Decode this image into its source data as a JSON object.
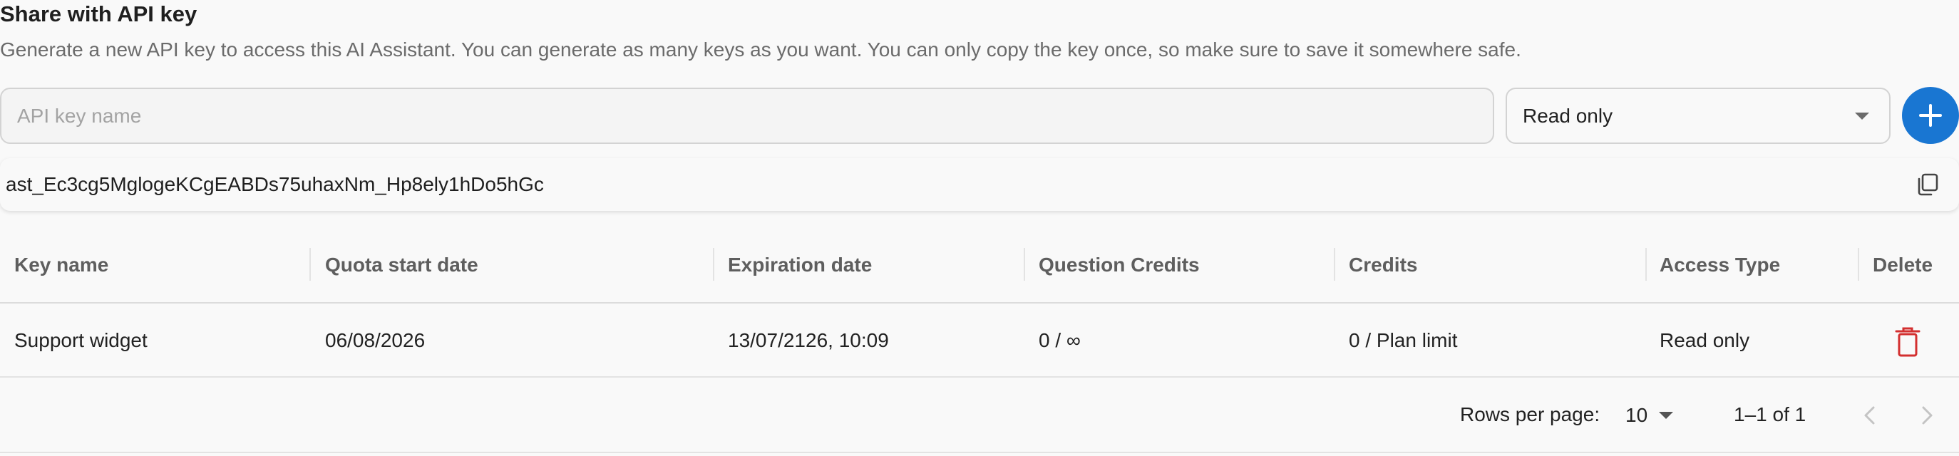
{
  "header": {
    "title": "Share with API key",
    "description": "Generate a new API key to access this AI Assistant. You can generate as many keys as you want. You can only copy the key once, so make sure to save it somewhere safe."
  },
  "form": {
    "name_placeholder": "API key name",
    "name_value": "",
    "access_selected": "Read only",
    "add_icon": "plus-icon",
    "accent_color": "#1976d2"
  },
  "generated_key": {
    "value": "ast_Ec3cg5MglogeKCgEABDs75uhaxNm_Hp8ely1hDo5hGc",
    "copy_icon": "copy-icon"
  },
  "table": {
    "columns": [
      "Key name",
      "Quota start date",
      "Expiration date",
      "Question Credits",
      "Credits",
      "Access Type",
      "Delete"
    ],
    "rows": [
      {
        "key_name": "Support widget",
        "quota_start": "06/08/2026",
        "expiration": "13/07/2126, 10:09",
        "question_credits": "0 / ∞",
        "credits": "0 / Plan limit",
        "access_type": "Read only",
        "delete_icon": "trash-icon",
        "delete_color": "#d32f2f"
      }
    ]
  },
  "pagination": {
    "rows_per_page_label": "Rows per page:",
    "rows_per_page_value": "10",
    "range": "1–1 of 1",
    "prev_icon": "chevron-left-icon",
    "next_icon": "chevron-right-icon"
  }
}
